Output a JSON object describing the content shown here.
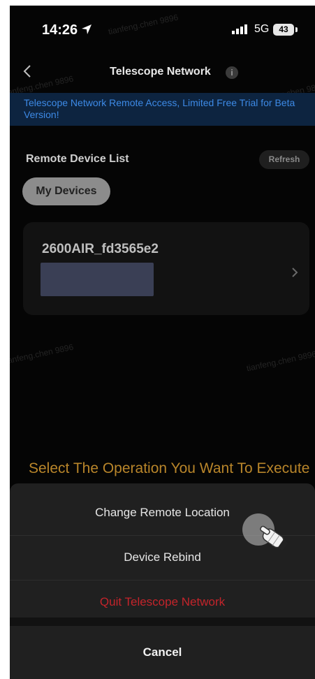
{
  "status_bar": {
    "time": "14:26",
    "network": "5G",
    "battery": "43"
  },
  "header": {
    "title": "Telescope Network",
    "info_glyph": "i"
  },
  "banner": {
    "text": "Telescope Network Remote Access, Limited Free Trial for Beta Version!"
  },
  "remote_list": {
    "title": "Remote Device List",
    "refresh_label": "Refresh",
    "tab_label": "My Devices",
    "device": {
      "name": "2600AIR_fd3565e2"
    }
  },
  "operation": {
    "prompt": "Select The Operation You Want To Execute",
    "items": [
      "Change Remote Location",
      "Device Rebind",
      "Quit Telescope Network"
    ],
    "cancel_label": "Cancel"
  },
  "watermark": {
    "text": "tianfeng.chen 9896"
  },
  "colors": {
    "accent_blue": "#3d8ae6",
    "prompt_orange": "#b8852a",
    "danger_red": "#c4242b"
  }
}
